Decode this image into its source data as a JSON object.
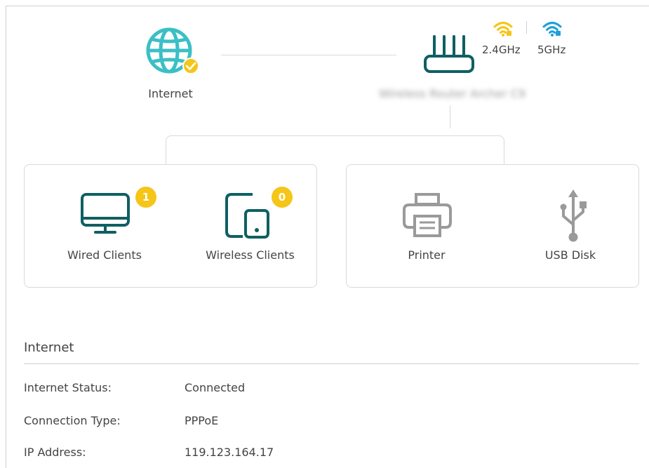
{
  "topology": {
    "internet_label": "Internet",
    "router_name": "Wireless Router Archer C9",
    "bands": [
      {
        "label": "2.4GHz",
        "color": "#f5c518"
      },
      {
        "label": "5GHz",
        "color": "#1e9fd6"
      }
    ]
  },
  "devices": {
    "wired": {
      "label": "Wired Clients",
      "count": "1"
    },
    "wireless": {
      "label": "Wireless Clients",
      "count": "0"
    },
    "printer": {
      "label": "Printer"
    },
    "usb": {
      "label": "USB Disk"
    }
  },
  "internet_section": {
    "title": "Internet",
    "rows": [
      {
        "key": "Internet Status:",
        "value": "Connected"
      },
      {
        "key": "Connection Type:",
        "value": "PPPoE"
      },
      {
        "key": "IP Address:",
        "value": "119.123.164.17"
      }
    ]
  },
  "colors": {
    "primary_teal": "#0f5f63",
    "globe_teal": "#3bbfc6",
    "badge_yellow": "#f5c518",
    "inactive_gray": "#9a9a9a"
  }
}
